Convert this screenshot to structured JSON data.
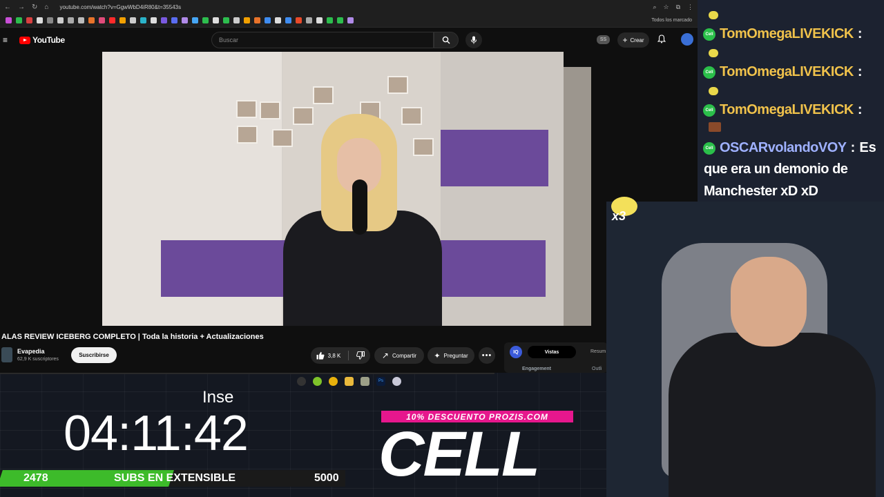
{
  "browser": {
    "url": "youtube.com/watch?v=GgwWbD4iR80&t=35543s",
    "bookmarks_folder": "Todos los marcado"
  },
  "youtube": {
    "logo_text": "YouTube",
    "search_placeholder": "Buscar",
    "ss_badge": "SS",
    "create_label": "Crear"
  },
  "video": {
    "title": "ALAS REVIEW ICEBERG COMPLETO | Toda la historia + Actualizaciones",
    "channel": "Evapedia",
    "subscribers": "62,9 K suscriptores",
    "subscribe_label": "Suscribirse",
    "likes": "3,8 K",
    "share_label": "Compartir",
    "ask_label": "Preguntar"
  },
  "side_panel": {
    "tab_active": "Vistas",
    "tab_other": "Resum",
    "engagement": "Engagement",
    "outline": "Outli"
  },
  "overlay": {
    "inse": "Inse",
    "timer": "04:11:42",
    "subs_current": "2478",
    "subs_label": "SUBS EN EXTENSIBLE",
    "subs_goal": "5000",
    "subs_progress_fraction": 0.4956,
    "promo": "10% DESCUENTO PROZIS.COM",
    "brand": "CELL",
    "x3": "x3"
  },
  "chat": {
    "messages": [
      {
        "user": "TomOmegaLIVEKICK",
        "text": ""
      },
      {
        "user": "TomOmegaLIVEKICK",
        "text": ""
      },
      {
        "user": "TomOmegaLIVEKICK",
        "text": ""
      },
      {
        "user": "OSCARvolandoVOY",
        "text": "Es"
      }
    ],
    "continuation_line1": "que era un demonio de",
    "continuation_line2": "Manchester xD xD"
  },
  "colors": {
    "yt_red": "#ff0000",
    "subs_green": "#3dbb2a",
    "promo_pink": "#e6178d",
    "chat_user_gold": "#f0c24b",
    "chat_user_blue": "#9fb1ff"
  }
}
